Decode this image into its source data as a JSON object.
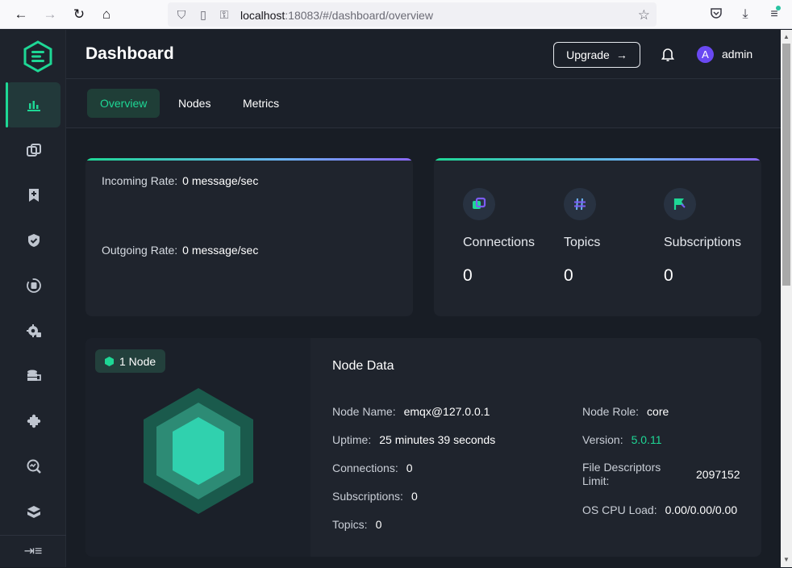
{
  "browser": {
    "url_host": "localhost",
    "url_rest": ":18083/#/dashboard/overview"
  },
  "sidebar": {
    "items": [
      {
        "name": "dashboard",
        "icon": "bar-chart-icon",
        "active": true
      },
      {
        "name": "connections",
        "icon": "connections-icon"
      },
      {
        "name": "subscriptions",
        "icon": "bookmark-add-icon"
      },
      {
        "name": "access-control",
        "icon": "shield-icon"
      },
      {
        "name": "integration",
        "icon": "data-sync-icon"
      },
      {
        "name": "management",
        "icon": "gear-icon"
      },
      {
        "name": "rules",
        "icon": "database-rules-icon"
      },
      {
        "name": "extensions",
        "icon": "puzzle-icon"
      },
      {
        "name": "diagnose",
        "icon": "search-analytics-icon"
      },
      {
        "name": "system",
        "icon": "stack-icon"
      }
    ],
    "collapse_icon": "collapse-menu-icon"
  },
  "header": {
    "title": "Dashboard",
    "upgrade_label": "Upgrade",
    "upgrade_arrow": "→",
    "avatar_letter": "A",
    "username": "admin"
  },
  "tabs": [
    {
      "label": "Overview",
      "active": true
    },
    {
      "label": "Nodes"
    },
    {
      "label": "Metrics"
    }
  ],
  "rates": {
    "incoming_label": "Incoming Rate:",
    "incoming_value": "0 message/sec",
    "outgoing_label": "Outgoing Rate:",
    "outgoing_value": "0 message/sec"
  },
  "stats": [
    {
      "label": "Connections",
      "value": "0",
      "icon": "connections-icon"
    },
    {
      "label": "Topics",
      "value": "0",
      "icon": "hash-icon"
    },
    {
      "label": "Subscriptions",
      "value": "0",
      "icon": "flag-icon"
    }
  ],
  "node": {
    "badge": "1 Node",
    "title": "Node Data",
    "left": [
      {
        "label": "Node Name:",
        "value": "emqx@127.0.0.1"
      },
      {
        "label": "Uptime:",
        "value": "25 minutes 39 seconds"
      },
      {
        "label": "Connections:",
        "value": "0"
      },
      {
        "label": "Subscriptions:",
        "value": "0"
      },
      {
        "label": "Topics:",
        "value": "0"
      }
    ],
    "role_label": "Node Role:",
    "role_value": "core",
    "version_label": "Version:",
    "version_value": "5.0.11",
    "fd_label": "File Descriptors Limit:",
    "fd_value": "2097152",
    "cpu_label": "OS CPU Load:",
    "cpu_value": "0.00/0.00/0.00"
  },
  "colors": {
    "accent": "#1ed795",
    "bg": "#181d25",
    "card": "#1f242d"
  }
}
